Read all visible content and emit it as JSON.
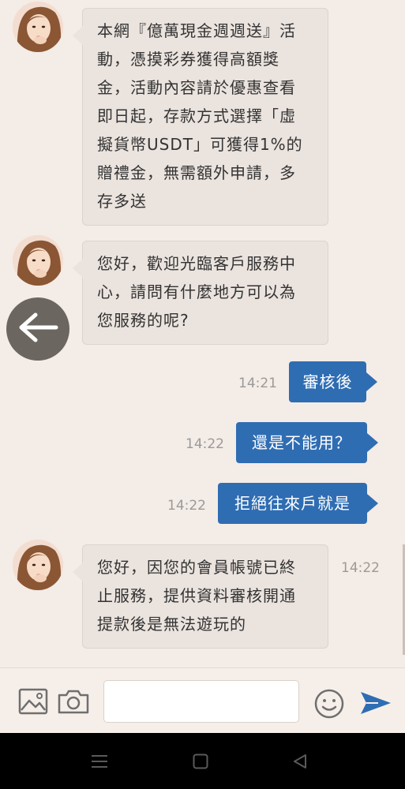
{
  "messages": [
    {
      "from": "agent",
      "text": "本網『億萬現金週週送』活動，憑摸彩券獲得高額獎金，活動內容請於優惠查看即日起，存款方式選擇「虛擬貨幣USDT」可獲得1%的贈禮金，無需額外申請，多存多送",
      "lines": [
        "本網『億萬現金週週送』活",
        "動，憑摸彩券獲得高額獎",
        "金，活動內容請於優惠查看",
        "即日起，存款方式選擇「虛",
        "擬貨幣USDT」可獲得1%的",
        "贈禮金，無需額外申請，多",
        "存多送"
      ]
    },
    {
      "from": "agent",
      "lines": [
        "您好，歡迎光臨客戶服務中",
        "心，請問有什麼地方可以為",
        "您服務的呢?"
      ]
    },
    {
      "from": "user",
      "text": "審核後",
      "time": "14:21"
    },
    {
      "from": "user",
      "text": "還是不能用？",
      "time": "14:22"
    },
    {
      "from": "user",
      "text": "拒絕往來戶就是",
      "time": "14:22"
    },
    {
      "from": "agent",
      "lines": [
        "您好，因您的會員帳號已終",
        "止服務，提供資料審核開通",
        "提款後是無法遊玩的"
      ],
      "time": "14:22"
    }
  ],
  "composer": {
    "placeholder": "",
    "value": ""
  },
  "icons": {
    "back": "arrow-left-icon",
    "image": "image-icon",
    "camera": "camera-icon",
    "emoji": "smiley-icon",
    "send": "send-icon",
    "nav_menu": "menu-icon",
    "nav_home": "home-icon",
    "nav_back": "back-triangle-icon"
  },
  "colors": {
    "background": "#f4ece6",
    "outgoing_bubble": "#2f6db3",
    "incoming_bubble": "#eae3de",
    "send": "#2f6db3"
  }
}
